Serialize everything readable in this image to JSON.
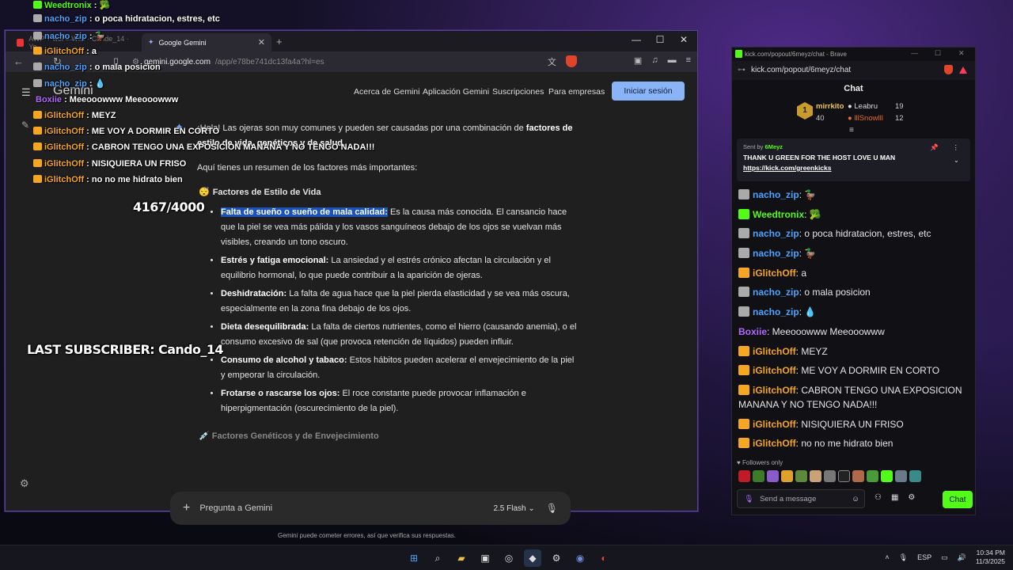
{
  "gemini_window": {
    "tabs": [
      {
        "label": "AWP + wol = WIN · Cande_14 · Yo"
      },
      {
        "label": "Google Gemini"
      }
    ],
    "url_host": "gemini.google.com",
    "url_path": "/app/e78be741dc13fa4a?hl=es",
    "logo": "Gemini",
    "nav": [
      "Acerca de Gemini",
      "Aplicación Gemini",
      "Suscripciones",
      "Para empresas"
    ],
    "signin": "Iniciar sesión",
    "intro_pre": "¡Hola! Las ojeras son muy comunes y pueden ser causadas por una combinación de ",
    "intro_bold": "factores de estilo de vida, genéticos y de salud.",
    "summary": "Aquí tienes un resumen de los factores más importantes:",
    "section1": "Factores de Estilo de Vida",
    "items": [
      {
        "title": "Falta de sueño o sueño de mala calidad:",
        "text": " Es la causa más conocida. El cansancio hace que la piel se vea más pálida y los vasos sanguíneos debajo de los ojos se vuelvan más visibles, creando un tono oscuro."
      },
      {
        "title": "Estrés y fatiga emocional:",
        "text": " La ansiedad y el estrés crónico afectan la circulación y el equilibrio hormonal, lo que puede contribuir a la aparición de ojeras."
      },
      {
        "title": "Deshidratación:",
        "text": " La falta de agua hace que la piel pierda elasticidad y se vea más oscura, especialmente en la zona fina debajo de los ojos."
      },
      {
        "title": "Dieta desequilibrada:",
        "text": " La falta de ciertos nutrientes, como el hierro (causando anemia), o el consumo excesivo de sal (que provoca retención de líquidos) pueden influir."
      },
      {
        "title": "Consumo de alcohol y tabaco:",
        "text": " Estos hábitos pueden acelerar el envejecimiento de la piel y empeorar la circulación."
      },
      {
        "title": "Frotarse o rascarse los ojos:",
        "text": " El roce constante puede provocar inflamación e hiperpigmentación (oscurecimiento de la piel)."
      }
    ],
    "section2": "Factores Genéticos y de Envejecimiento",
    "prompt_placeholder": "Pregunta a Gemini",
    "model": "2.5 Flash",
    "disclaimer": "Gemini puede cometer errores, así que verifica sus respuestas."
  },
  "kick_window": {
    "title": "kick.com/popout/6meyz/chat - Brave",
    "url": "kick.com/popout/6meyz/chat",
    "header": "Chat",
    "leaderboard": [
      {
        "name": "mirrkito",
        "count": "40"
      },
      {
        "name": "Leabru",
        "count": "19"
      },
      {
        "name": "lllSnowlll",
        "count": "12"
      }
    ],
    "rank": "1",
    "pinned": {
      "sent_by": "Sent by",
      "sender": "6Meyz",
      "message": "THANK U GREEN FOR THE HOST LOVE U MAN",
      "link": "https://kick.com/greenkicks"
    },
    "messages": [
      {
        "user": "nacho_zip",
        "text": ": 🦆",
        "color": "#4da3ff"
      },
      {
        "user": "Weedtronix",
        "text": ": 🥦",
        "color": "#53fc18"
      },
      {
        "user": "nacho_zip",
        "text": ": o poca hidratacion, estres, etc",
        "color": "#4da3ff"
      },
      {
        "user": "nacho_zip",
        "text": ": 🦆",
        "color": "#4da3ff"
      },
      {
        "user": "iGlitchOff",
        "text": ": a",
        "color": "#f5a623"
      },
      {
        "user": "nacho_zip",
        "text": ": o mala posicion",
        "color": "#4da3ff"
      },
      {
        "user": "nacho_zip",
        "text": ": 💧",
        "color": "#4da3ff"
      },
      {
        "user": "Boxiie",
        "text": ": Meeooowww Meeooowww",
        "color": "#b467ff"
      },
      {
        "user": "iGlitchOff",
        "text": ": MEYZ",
        "color": "#f5a623"
      },
      {
        "user": "iGlitchOff",
        "text": ": ME VOY A DORMIR EN CORTO",
        "color": "#f5a623"
      },
      {
        "user": "iGlitchOff",
        "text": ": CABRON TENGO UNA EXPOSICION MANANA Y NO TENGO NADA!!!",
        "color": "#f5a623"
      },
      {
        "user": "iGlitchOff",
        "text": ": NISIQUIERA UN FRISO",
        "color": "#f5a623"
      },
      {
        "user": "iGlitchOff",
        "text": ": no no me hidrato bien",
        "color": "#f5a623"
      }
    ],
    "followers_only": "Followers only",
    "send_placeholder": "Send a message",
    "chat_button": "Chat"
  },
  "overlay": {
    "lines": [
      {
        "user": "Weedtronix",
        "text": " : 🥦",
        "color": "#53fc18"
      },
      {
        "user": "nacho_zip",
        "text": " : o poca hidratacion, estres, etc",
        "color": "#4da3ff"
      },
      {
        "user": "nacho_zip",
        "text": " : 🦆",
        "color": "#4da3ff"
      },
      {
        "user": "iGlitchOff",
        "text": " : a",
        "color": "#f5a623"
      },
      {
        "user": "nacho_zip",
        "text": " : o mala posicion",
        "color": "#4da3ff"
      },
      {
        "user": "nacho_zip",
        "text": " : 💧",
        "color": "#4da3ff"
      },
      {
        "user": "Boxiie",
        "text": " : Meeooowww Meeooowww",
        "color": "#b467ff"
      },
      {
        "user": "iGlitchOff",
        "text": " : MEYZ",
        "color": "#f5a623"
      },
      {
        "user": "iGlitchOff",
        "text": " : ME VOY A DORMIR EN CORTO",
        "color": "#f5a623"
      },
      {
        "user": "iGlitchOff",
        "text": " : CABRON TENGO UNA EXPOSICION MANANA Y NO TENGO NADA!!!",
        "color": "#f5a623"
      },
      {
        "user": "iGlitchOff",
        "text": " : NISIQUIERA UN FRISO",
        "color": "#f5a623"
      },
      {
        "user": "iGlitchOff",
        "text": " : no no me hidrato bien",
        "color": "#f5a623"
      }
    ],
    "counter": "4167/4000",
    "last_subscriber": "LAST SUBSCRIBER: Cando_14"
  },
  "taskbar": {
    "lang": "ESP",
    "time": "10:34 PM",
    "date": "11/3/2025"
  }
}
